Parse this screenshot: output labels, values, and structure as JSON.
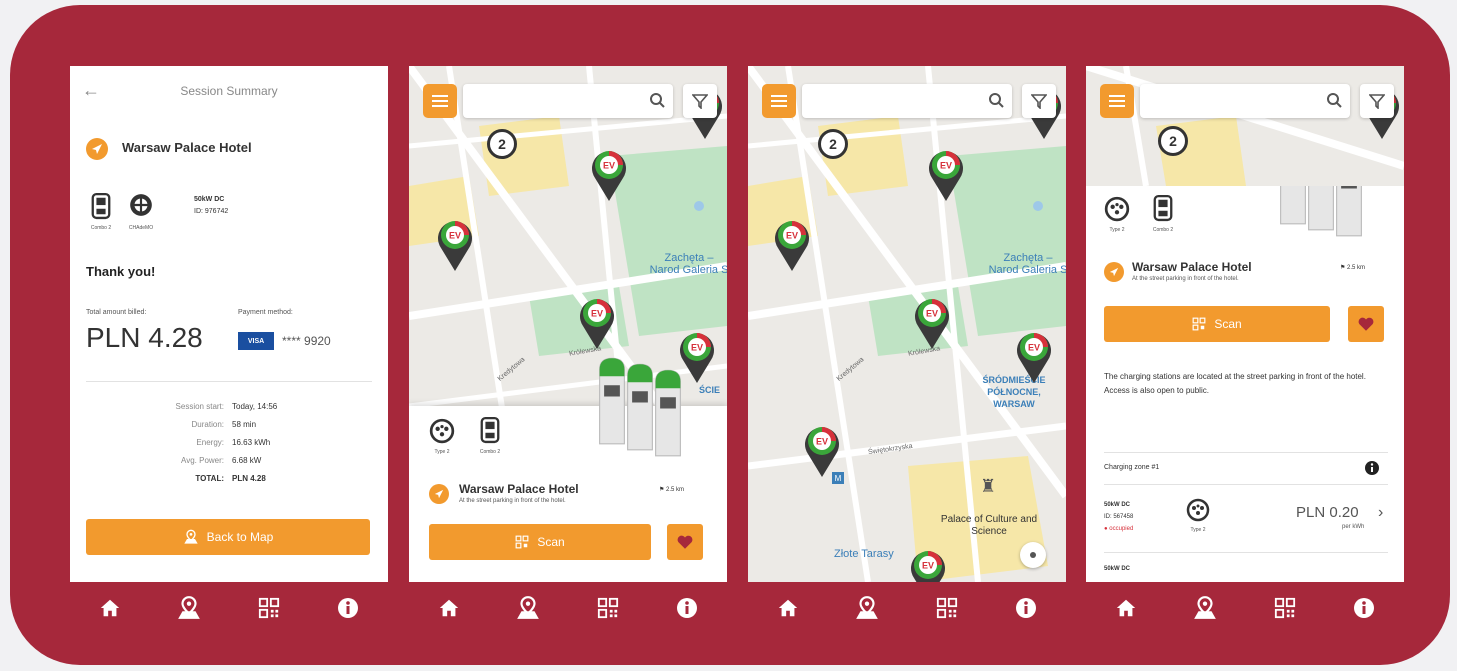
{
  "colors": {
    "brand": "#a6283b",
    "accent": "#f29a2e",
    "pin_green": "#3aa63a",
    "pin_red": "#d6313b"
  },
  "summary": {
    "title": "Session Summary",
    "location": "Warsaw Palace Hotel",
    "connectors": [
      {
        "label": "Combo 2"
      },
      {
        "label": "CHAdeMO"
      }
    ],
    "power_label": "50kW DC",
    "station_id": "ID: 976742",
    "thank_you": "Thank you!",
    "amount_label": "Total amount billed:",
    "amount": "PLN 4.28",
    "payment_label": "Payment method:",
    "card_brand": "VISA",
    "card_number": "**** 9920",
    "rows": [
      {
        "k": "Session start:",
        "v": "Today, 14:56"
      },
      {
        "k": "Duration:",
        "v": "58 min"
      },
      {
        "k": "Energy:",
        "v": "16.63 kWh"
      },
      {
        "k": "Avg. Power:",
        "v": "6.68 kW"
      },
      {
        "k": "TOTAL:",
        "v": "PLN 4.28"
      }
    ],
    "back_button": "Back to Map"
  },
  "map2": {
    "cluster_count": "2",
    "label_zacheta": "Zachęta – Narod Galeria S",
    "street1": "Kredytowa",
    "street2": "Królewska",
    "label_srodmiescie": "ŚCIE",
    "card": {
      "connectors": [
        {
          "label": "Type 2"
        },
        {
          "label": "Combo 2"
        }
      ],
      "title": "Warsaw Palace Hotel",
      "subtitle": "At the street parking in front of the hotel.",
      "distance": "2.5 km",
      "scan": "Scan"
    }
  },
  "map3": {
    "cluster_count": "2",
    "label_zacheta": "Zachęta – Narod Galeria S",
    "street1": "Kredytowa",
    "street2": "Królewska",
    "street3": "Świętokrzyska",
    "label_srodmiescie": "ŚRÓDMIEŚCIE PÓŁNOCNE, WARSAW",
    "label_palace": "Palace of Culture and Science",
    "label_zlote": "Złote Tarasy"
  },
  "detail": {
    "cluster_count": "2",
    "connectors": [
      {
        "label": "Type 2"
      },
      {
        "label": "Combo 2"
      }
    ],
    "title": "Warsaw Palace Hotel",
    "subtitle": "At the street parking in front of the hotel.",
    "distance": "2.5 km",
    "scan": "Scan",
    "description": "The charging stations are located at the street parking in front of the hotel. Access is also open to public.",
    "zone_label": "Charging zone #1",
    "charger": {
      "power": "50kW DC",
      "id": "ID: 567458",
      "status": "occupied",
      "connector": "Type 2",
      "price": "PLN 0.20",
      "unit": "per kWh"
    },
    "charger2_power": "50kW DC"
  },
  "nav": [
    {
      "icon": "home-icon"
    },
    {
      "icon": "map-pin-icon"
    },
    {
      "icon": "qr-code-icon"
    },
    {
      "icon": "info-icon"
    }
  ]
}
